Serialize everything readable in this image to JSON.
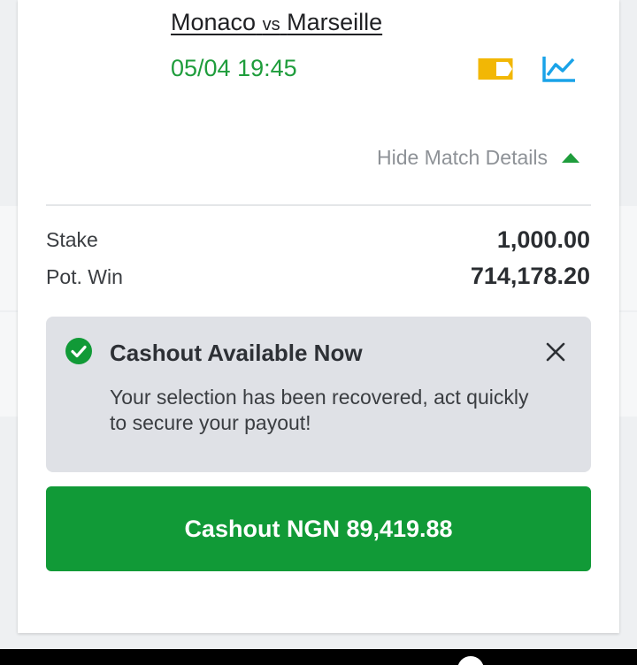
{
  "match": {
    "home": "Monaco",
    "vs": "vs",
    "away": "Marseille",
    "datetime": "05/04 19:45"
  },
  "icons": {
    "tag": "ticket-tag-icon",
    "stats": "line-chart-icon",
    "check": "check-circle-icon",
    "close": "close-icon",
    "caret": "caret-up-icon"
  },
  "details_toggle": {
    "label": "Hide Match Details"
  },
  "summary": {
    "stake_label": "Stake",
    "stake_value": "1,000.00",
    "potwin_label": "Pot. Win",
    "potwin_value": "714,178.20"
  },
  "notice": {
    "title": "Cashout Available Now",
    "body": "Your selection has been recovered, act quickly to secure your payout!"
  },
  "cashout_button": {
    "label": "Cashout NGN 89,419.88"
  },
  "colors": {
    "brand_green": "#119a37",
    "time_green": "#1f9d3c",
    "tag_yellow": "#f2b705",
    "stats_blue": "#1aa3e8",
    "notice_bg": "#dfe1e6"
  }
}
